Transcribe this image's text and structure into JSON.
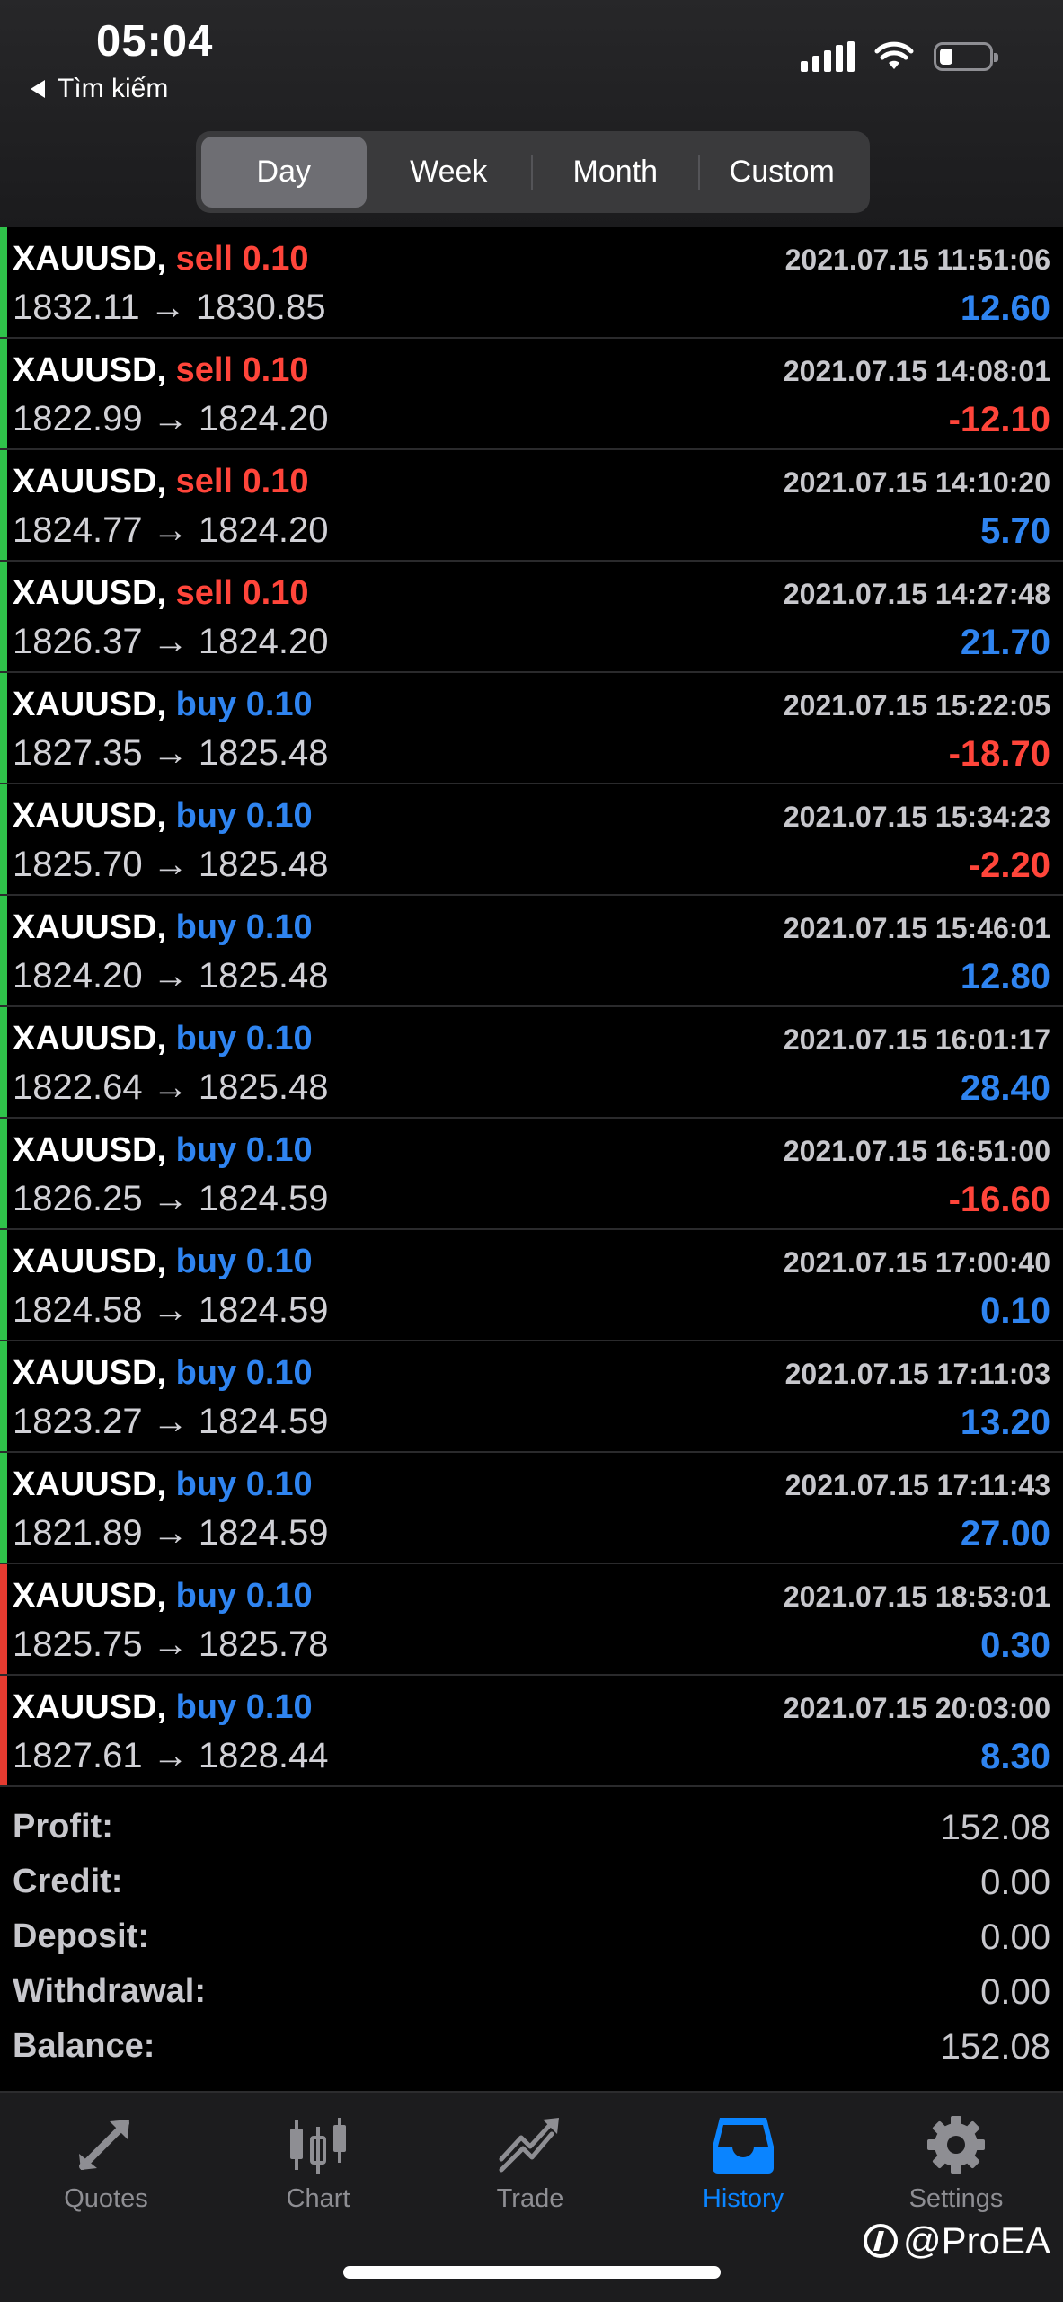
{
  "status_bar": {
    "time": "05:04",
    "back_label": "Tìm kiếm"
  },
  "colors": {
    "sell": "#ff453a",
    "buy": "#2f84f0",
    "loss": "#ff453a",
    "gain": "#2f84f0",
    "active_tab": "#0a84ff",
    "inactive_tab": "#8e8e93",
    "bar_green": "#2fc24a",
    "bar_red": "#e53b30"
  },
  "period_tabs": [
    {
      "label": "Day",
      "active": true
    },
    {
      "label": "Week",
      "active": false
    },
    {
      "label": "Month",
      "active": false
    },
    {
      "label": "Custom",
      "active": false
    }
  ],
  "deals": [
    {
      "symbol": "XAUUSD,",
      "side": "sell",
      "volume": "0.10",
      "open": "1832.11",
      "close": "1830.85",
      "time": "2021.07.15 11:51:06",
      "profit": "12.60",
      "bar": "green"
    },
    {
      "symbol": "XAUUSD,",
      "side": "sell",
      "volume": "0.10",
      "open": "1822.99",
      "close": "1824.20",
      "time": "2021.07.15 14:08:01",
      "profit": "-12.10",
      "bar": "green"
    },
    {
      "symbol": "XAUUSD,",
      "side": "sell",
      "volume": "0.10",
      "open": "1824.77",
      "close": "1824.20",
      "time": "2021.07.15 14:10:20",
      "profit": "5.70",
      "bar": "green"
    },
    {
      "symbol": "XAUUSD,",
      "side": "sell",
      "volume": "0.10",
      "open": "1826.37",
      "close": "1824.20",
      "time": "2021.07.15 14:27:48",
      "profit": "21.70",
      "bar": "green"
    },
    {
      "symbol": "XAUUSD,",
      "side": "buy",
      "volume": "0.10",
      "open": "1827.35",
      "close": "1825.48",
      "time": "2021.07.15 15:22:05",
      "profit": "-18.70",
      "bar": "green"
    },
    {
      "symbol": "XAUUSD,",
      "side": "buy",
      "volume": "0.10",
      "open": "1825.70",
      "close": "1825.48",
      "time": "2021.07.15 15:34:23",
      "profit": "-2.20",
      "bar": "green"
    },
    {
      "symbol": "XAUUSD,",
      "side": "buy",
      "volume": "0.10",
      "open": "1824.20",
      "close": "1825.48",
      "time": "2021.07.15 15:46:01",
      "profit": "12.80",
      "bar": "green"
    },
    {
      "symbol": "XAUUSD,",
      "side": "buy",
      "volume": "0.10",
      "open": "1822.64",
      "close": "1825.48",
      "time": "2021.07.15 16:01:17",
      "profit": "28.40",
      "bar": "green"
    },
    {
      "symbol": "XAUUSD,",
      "side": "buy",
      "volume": "0.10",
      "open": "1826.25",
      "close": "1824.59",
      "time": "2021.07.15 16:51:00",
      "profit": "-16.60",
      "bar": "green"
    },
    {
      "symbol": "XAUUSD,",
      "side": "buy",
      "volume": "0.10",
      "open": "1824.58",
      "close": "1824.59",
      "time": "2021.07.15 17:00:40",
      "profit": "0.10",
      "bar": "green"
    },
    {
      "symbol": "XAUUSD,",
      "side": "buy",
      "volume": "0.10",
      "open": "1823.27",
      "close": "1824.59",
      "time": "2021.07.15 17:11:03",
      "profit": "13.20",
      "bar": "green"
    },
    {
      "symbol": "XAUUSD,",
      "side": "buy",
      "volume": "0.10",
      "open": "1821.89",
      "close": "1824.59",
      "time": "2021.07.15 17:11:43",
      "profit": "27.00",
      "bar": "green"
    },
    {
      "symbol": "XAUUSD,",
      "side": "buy",
      "volume": "0.10",
      "open": "1825.75",
      "close": "1825.78",
      "time": "2021.07.15 18:53:01",
      "profit": "0.30",
      "bar": "red"
    },
    {
      "symbol": "XAUUSD,",
      "side": "buy",
      "volume": "0.10",
      "open": "1827.61",
      "close": "1828.44",
      "time": "2021.07.15 20:03:00",
      "profit": "8.30",
      "bar": "red"
    }
  ],
  "arrow": "→",
  "summary": [
    {
      "label": "Profit:",
      "value": "152.08"
    },
    {
      "label": "Credit:",
      "value": "0.00"
    },
    {
      "label": "Deposit:",
      "value": "0.00"
    },
    {
      "label": "Withdrawal:",
      "value": "0.00"
    },
    {
      "label": "Balance:",
      "value": "152.08"
    }
  ],
  "tabbar": [
    {
      "label": "Quotes",
      "icon": "quotes-icon",
      "active": false
    },
    {
      "label": "Chart",
      "icon": "chart-icon",
      "active": false
    },
    {
      "label": "Trade",
      "icon": "trade-icon",
      "active": false
    },
    {
      "label": "History",
      "icon": "history-icon",
      "active": true
    },
    {
      "label": "Settings",
      "icon": "settings-icon",
      "active": false
    }
  ],
  "watermark": "@ProEA"
}
